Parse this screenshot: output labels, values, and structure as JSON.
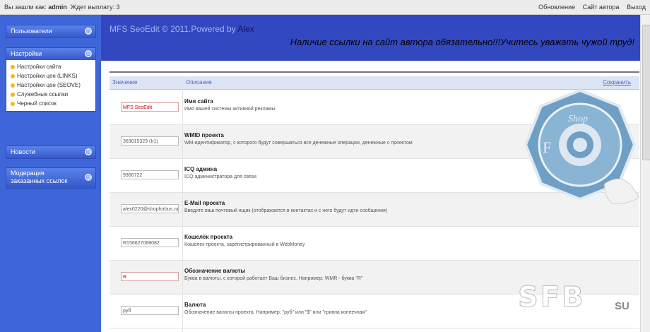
{
  "topbar": {
    "login_prefix": "Вы зашли как:",
    "username": "admin",
    "exit_prefix": "Ждет выплату: 3",
    "links": [
      "Обновление",
      "Сайт автора",
      "Выход"
    ]
  },
  "sidebar": {
    "blocks": [
      {
        "title": "Пользователи",
        "items": []
      },
      {
        "title": "Настройки",
        "items": [
          "Настройки сайта",
          "Настройки цен (LINKS)",
          "Настройки цен (SEOVE)",
          "Служебные ссылки",
          "Черный список"
        ]
      },
      {
        "title": "Новости",
        "items": []
      },
      {
        "title": "Модерация заказанных ссылок",
        "items": []
      }
    ],
    "toggle_glyph": "◎"
  },
  "banner": {
    "title": "MFS SeoEdit © 2011.Powered by ",
    "author": "Alex",
    "notice": "Наличие ссылки на сайт автора обязательно!!!Учитесь уважать чужой труд!"
  },
  "table": {
    "col_value": "Значение",
    "col_desc": "Описание",
    "save_link": "Сохранить",
    "rows": [
      {
        "value": "MFS SeoEdit",
        "label": "Имя сайта",
        "desc": "Имя вашей системы активной рекламы",
        "red": true
      },
      {
        "value": "363015329 (Ir1)",
        "label": "WMID проекта",
        "desc": "WM-идентификатор, с которого будут совершаться все денежные операции, денежные с проектом",
        "red": false
      },
      {
        "value": "9366722",
        "label": "ICQ админа",
        "desc": "ICQ администратора для связи",
        "red": false
      },
      {
        "value": "alex0220@shopforbus.ru",
        "label": "E-Mail проекта",
        "desc": "Введите ваш почтовый ящик (отображается в контактах и с него будут идти сообщения)",
        "red": false
      },
      {
        "value": "R156627088082",
        "label": "Кошелёк проекта",
        "desc": "Кошелек проекта, зарегистрированный в WebMoney",
        "red": false
      },
      {
        "value": "R",
        "label": "Обозначение валюты",
        "desc": "Буква в валюты, с которой работает Ваш бизнес. Например: WMR - буква \"R\"",
        "red": true
      },
      {
        "value": "руб",
        "label": "Валюта",
        "desc": "Обозначение валюты проекта. Например: \"руб\" или \"$\" или \"гривна копеечная\"",
        "red": false
      }
    ]
  },
  "watermark": {
    "shop": "Shop",
    "letter_f": "F",
    "letter_b": "B",
    "site": "SFB",
    "tld": "SU"
  }
}
